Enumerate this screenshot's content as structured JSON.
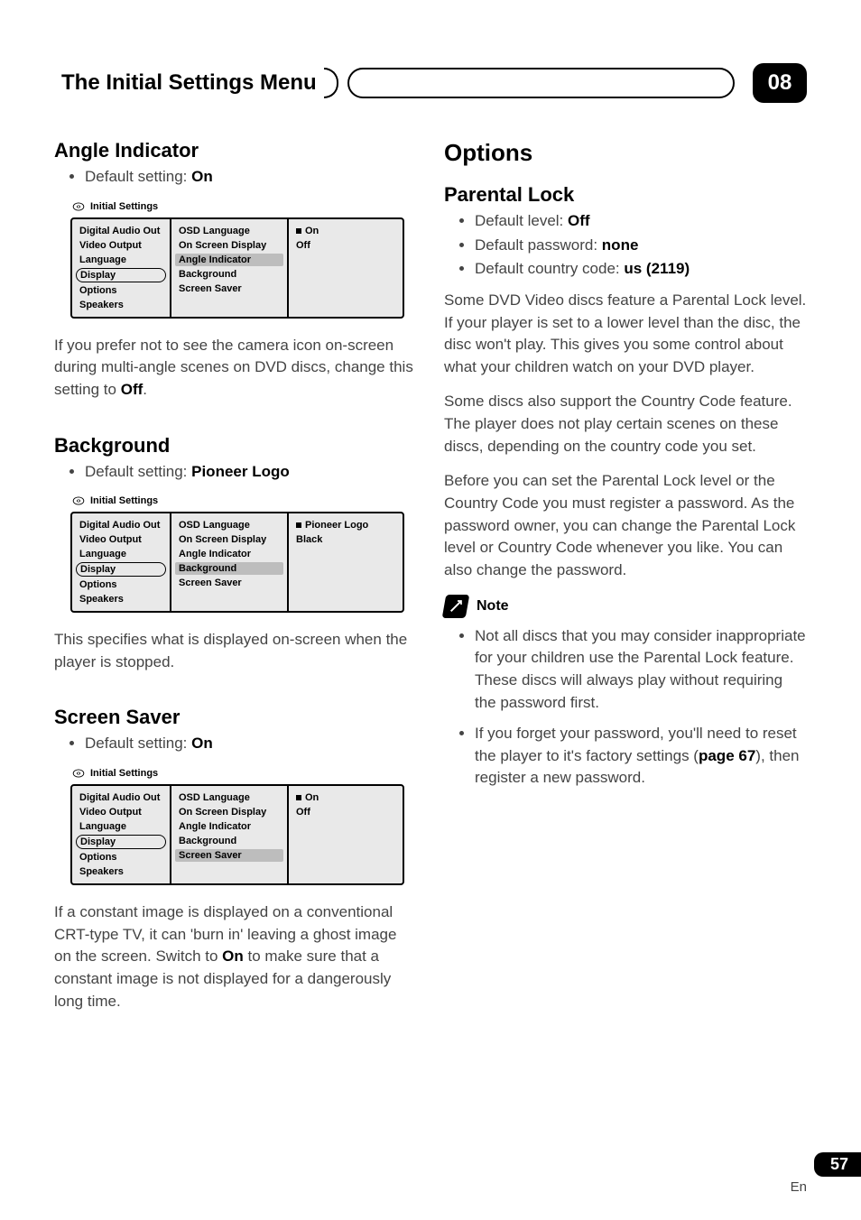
{
  "header": {
    "title": "The Initial Settings Menu",
    "chapter": "08"
  },
  "left": {
    "sec1": {
      "heading": "Angle Indicator",
      "bullet_pre": "Default setting: ",
      "bullet_val": "On",
      "para_pre": "If you prefer not to see the camera icon on-screen during multi-angle scenes on DVD discs, change this setting to ",
      "para_val": "Off",
      "para_post": "."
    },
    "sec2": {
      "heading": "Background",
      "bullet_pre": "Default setting: ",
      "bullet_val": "Pioneer Logo",
      "para": "This specifies what is displayed on-screen when the player is stopped."
    },
    "sec3": {
      "heading": "Screen Saver",
      "bullet_pre": "Default setting: ",
      "bullet_val": "On",
      "para_pre": "If a constant image is displayed on a conventional CRT-type TV, it can 'burn in' leaving a ghost image on the screen. Switch to ",
      "para_val": "On",
      "para_post": " to make sure that a constant image is not displayed for a dangerously long time."
    }
  },
  "right": {
    "heading": "Options",
    "sub": "Parental Lock",
    "b1_pre": "Default level: ",
    "b1_val": "Off",
    "b2_pre": "Default password: ",
    "b2_val": "none",
    "b3_pre": "Default country code: ",
    "b3_val": "us (2119)",
    "p1": "Some DVD Video discs feature a Parental Lock level. If your player is set to a lower level than the disc, the disc won't play. This gives you some control about what your children watch on your DVD player.",
    "p2": "Some discs also support the Country Code feature. The player does not play certain scenes on these discs, depending on the country code you set.",
    "p3": "Before you can set the Parental Lock level or the Country Code you must register a password. As the password owner, you can change the Parental Lock level or Country Code whenever you like. You can also change the password.",
    "note_label": "Note",
    "n1": "Not all discs that you may consider inappropriate for your children use the Parental Lock feature. These discs will always play without requiring the password first.",
    "n2_pre": "If you forget your password, you'll need to reset the player to it's factory settings (",
    "n2_bold": "page 67",
    "n2_post": "), then register a new password."
  },
  "ui": {
    "title": "Initial Settings",
    "col1": [
      "Digital Audio Out",
      "Video Output",
      "Language",
      "Display",
      "Options",
      "Speakers"
    ],
    "col2": [
      "OSD Language",
      "On Screen Display",
      "Angle Indicator",
      "Background",
      "Screen Saver"
    ],
    "onoff": [
      "On",
      "Off"
    ],
    "logo": [
      "Pioneer Logo",
      "Black"
    ]
  },
  "footer": {
    "page": "57",
    "lang": "En"
  }
}
